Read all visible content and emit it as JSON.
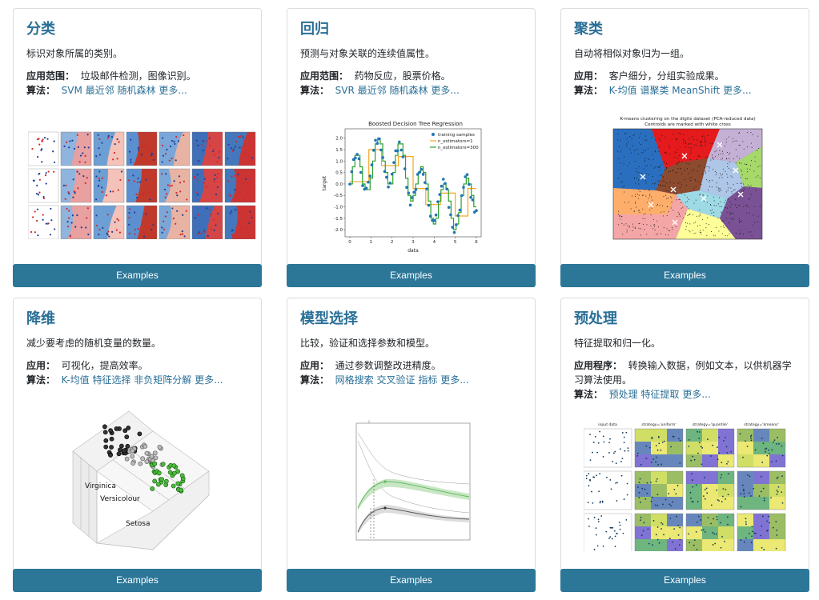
{
  "button_label": "Examples",
  "cards": [
    {
      "title": "分类",
      "desc": "标识对象所属的类别。",
      "app_label": "应用范围：",
      "app_text": "垃圾邮件检测，图像识别。",
      "alg_label": "算法：",
      "alg_links": [
        "SVM",
        "最近邻",
        "随机森林",
        "更多..."
      ]
    },
    {
      "title": "回归",
      "desc": "预测与对象关联的连续值属性。",
      "app_label": "应用范围：",
      "app_text": "药物反应，股票价格。",
      "alg_label": "算法：",
      "alg_links": [
        "SVR",
        "最近邻",
        "随机森林",
        "更多..."
      ]
    },
    {
      "title": "聚类",
      "desc": "自动将相似对象归为一组。",
      "app_label": "应用：",
      "app_text": "客户细分，分组实验成果。",
      "alg_label": "算法：",
      "alg_links": [
        "K-均值",
        "谱聚类",
        "MeanShift",
        "更多..."
      ]
    },
    {
      "title": "降维",
      "desc": "减少要考虑的随机变量的数量。",
      "app_label": "应用：",
      "app_text": "可视化，提高效率。",
      "alg_label": "算法：",
      "alg_links": [
        "K-均值",
        "特征选择",
        "非负矩阵分解",
        "更多..."
      ]
    },
    {
      "title": "模型选择",
      "desc": "比较，验证和选择参数和模型。",
      "app_label": "应用：",
      "app_text": "通过参数调整改进精度。",
      "alg_label": "算法：",
      "alg_links": [
        "网格搜索",
        "交叉验证",
        "指标",
        "更多..."
      ]
    },
    {
      "title": "预处理",
      "desc": "特征提取和归一化。",
      "app_label": "应用程序：",
      "app_text": "转换输入数据，例如文本，以供机器学习算法使用。",
      "alg_label": "算法：",
      "alg_links": [
        "预处理",
        "特征提取",
        "更多..."
      ]
    }
  ],
  "figures": {
    "regression": {
      "title": "Boosted Decision Tree Regression",
      "xlabel": "data",
      "ylabel": "target",
      "legend": [
        "training samples",
        "n_estimators=1",
        "n_estimators=300"
      ],
      "yticks": [
        "2.0",
        "1.5",
        "1.0",
        "0.5",
        "0.0",
        "-0.5",
        "-1.0",
        "-1.5",
        "-2.0"
      ],
      "xticks": [
        "0",
        "1",
        "2",
        "3",
        "4",
        "5",
        "6"
      ]
    },
    "clustering": {
      "title_line1": "K-means clustering on the digits dataset (PCA-reduced data)",
      "title_line2": "Centroids are marked with white cross"
    },
    "dimred": {
      "labels": [
        "Virginica",
        "Versicolour",
        "Setosa"
      ]
    },
    "preprocessing": {
      "col_titles": [
        "input data",
        "strategy='uniform'",
        "strategy='quantile'",
        "strategy='kmeans'"
      ]
    }
  }
}
